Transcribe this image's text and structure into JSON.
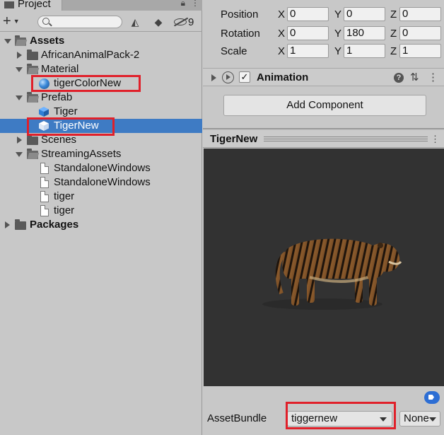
{
  "project_panel": {
    "tab_label": "Project",
    "hidden_count": "9",
    "tree": [
      {
        "label": "Assets",
        "icon": "folder-open-icon",
        "bold": true
      },
      {
        "label": "AfricanAnimalPack-2",
        "icon": "folder-icon"
      },
      {
        "label": "Material",
        "icon": "folder-open-icon"
      },
      {
        "label": "tigerColorNew",
        "icon": "material-icon",
        "highlighted": true
      },
      {
        "label": "Prefab",
        "icon": "folder-open-icon"
      },
      {
        "label": "Tiger",
        "icon": "prefab-cube-icon"
      },
      {
        "label": "TigerNew",
        "icon": "prefab-cube-icon",
        "selected": true,
        "highlighted": true
      },
      {
        "label": "Scenes",
        "icon": "folder-icon"
      },
      {
        "label": "StreamingAssets",
        "icon": "folder-open-icon"
      },
      {
        "label": "StandaloneWindows",
        "icon": "file-icon"
      },
      {
        "label": "StandaloneWindows",
        "icon": "file-icon"
      },
      {
        "label": "tiger",
        "icon": "file-icon"
      },
      {
        "label": "tiger",
        "icon": "file-icon"
      },
      {
        "label": "Packages",
        "icon": "folder-icon",
        "bold": true
      }
    ]
  },
  "inspector": {
    "transform": [
      {
        "name": "Position",
        "x": "0",
        "y": "0",
        "z": "0"
      },
      {
        "name": "Rotation",
        "x": "0",
        "y": "180",
        "z": "0"
      },
      {
        "name": "Scale",
        "x": "1",
        "y": "1",
        "z": "1"
      }
    ],
    "axis_labels": {
      "x": "X",
      "y": "Y",
      "z": "Z"
    },
    "component": {
      "title": "Animation",
      "enabled": true
    },
    "add_component_label": "Add Component",
    "preview_title": "TigerNew",
    "asset_bundle": {
      "label": "AssetBundle",
      "name": "tiggernew",
      "variant": "None"
    }
  },
  "colors": {
    "selection": "#3e7bc4",
    "highlight_box": "#e0202a",
    "viewport_bg": "#323232"
  }
}
